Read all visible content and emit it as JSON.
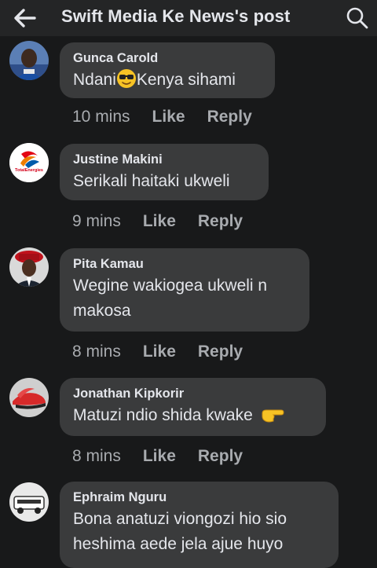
{
  "header": {
    "title": "Swift Media Ke News's post",
    "back_icon": "arrow-left-icon",
    "search_icon": "search-icon"
  },
  "comments": [
    {
      "author": "Gunca Carold",
      "text_before": "Ndani",
      "emoji": "sunglasses-face-emoji",
      "text_after": "Kenya sihami",
      "time": "10 mins",
      "like_label": "Like",
      "reply_label": "Reply"
    },
    {
      "author": "Justine Makini",
      "text": "Serikali haitaki ukweli",
      "avatar_logo": "TotalEnergies",
      "time": "9 mins",
      "like_label": "Like",
      "reply_label": "Reply"
    },
    {
      "author": "Pita Kamau",
      "text_line1": "Wegine wakiogea ukweli n",
      "text_line2": "makosa",
      "time": "8 mins",
      "like_label": "Like",
      "reply_label": "Reply"
    },
    {
      "author": "Jonathan Kipkorir",
      "text": "Matuzi ndio shida kwake",
      "emoji": "pointing-right-emoji",
      "time": "8 mins",
      "like_label": "Like",
      "reply_label": "Reply"
    },
    {
      "author": "Ephraim Nguru",
      "text_line1": "Bona anatuzi viongozi hio sio",
      "text_line2": "heshima aede jela ajue huyo"
    }
  ],
  "colors": {
    "background": "#18191a",
    "header": "#242526",
    "bubble": "#3a3b3c",
    "primary_text": "#e4e6eb",
    "secondary_text": "#a8abaf"
  }
}
